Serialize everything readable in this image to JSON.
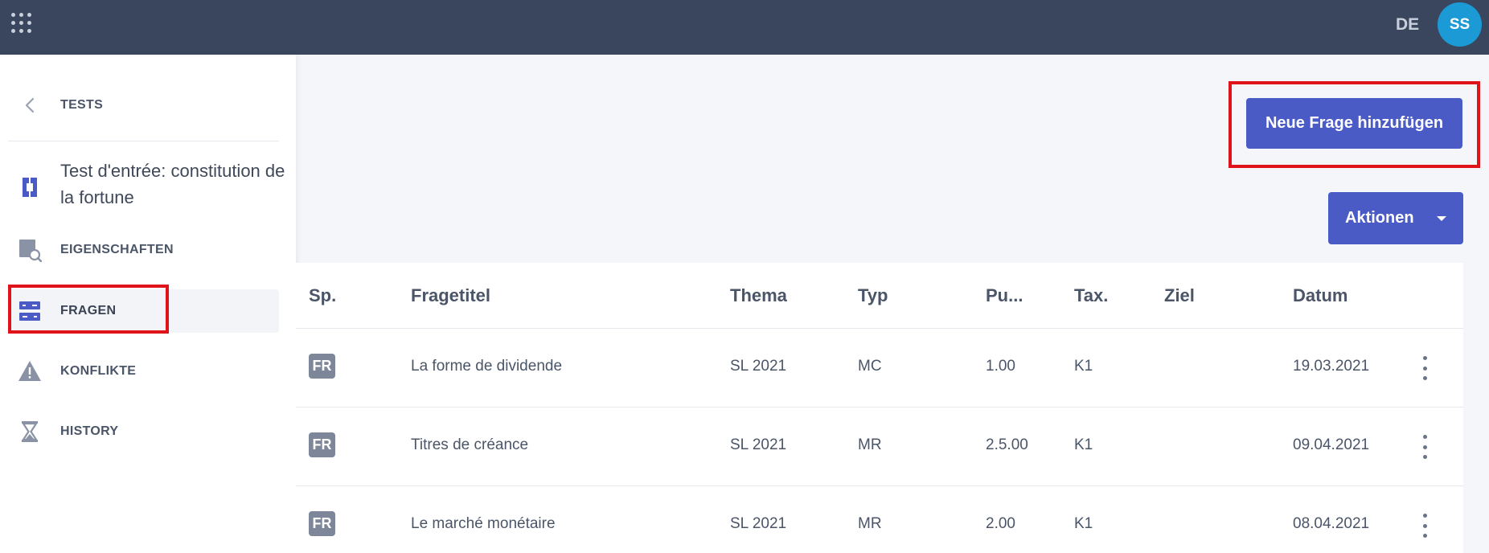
{
  "topbar": {
    "apps_icon": "apps-grid-icon",
    "language": "DE",
    "avatar_initials": "SS"
  },
  "sidebar": {
    "back_label": "TESTS",
    "test_title": "Test d'entrée: constitution de la fortune",
    "items": [
      {
        "label": "EIGENSCHAFTEN",
        "icon": "properties-search-icon"
      },
      {
        "label": "FRAGEN",
        "icon": "questions-icon"
      },
      {
        "label": "KONFLIKTE",
        "icon": "warning-icon"
      },
      {
        "label": "HISTORY",
        "icon": "hourglass-icon"
      }
    ]
  },
  "main": {
    "add_button_label": "Neue Frage hinzufügen",
    "actions_label": "Aktionen"
  },
  "table": {
    "columns": [
      "Sp.",
      "Fragetitel",
      "Thema",
      "Typ",
      "Pu...",
      "Tax.",
      "Ziel",
      "Datum"
    ],
    "rows": [
      {
        "lang": "FR",
        "title": "La forme de dividende",
        "topic": "SL 2021",
        "type": "MC",
        "points": "1.00",
        "tax": "K1",
        "goal": "",
        "date": "19.03.2021"
      },
      {
        "lang": "FR",
        "title": "Titres de créance",
        "topic": "SL 2021",
        "type": "MR",
        "points": "2.5.00",
        "tax": "K1",
        "goal": "",
        "date": "09.04.2021"
      },
      {
        "lang": "FR",
        "title": "Le marché monétaire",
        "topic": "SL 2021",
        "type": "MR",
        "points": "2.00",
        "tax": "K1",
        "goal": "",
        "date": "08.04.2021"
      }
    ]
  },
  "colors": {
    "topbar": "#3a465e",
    "primary_button": "#4a5bc6",
    "avatar": "#1b9ad6",
    "highlight": "#e0121a"
  }
}
